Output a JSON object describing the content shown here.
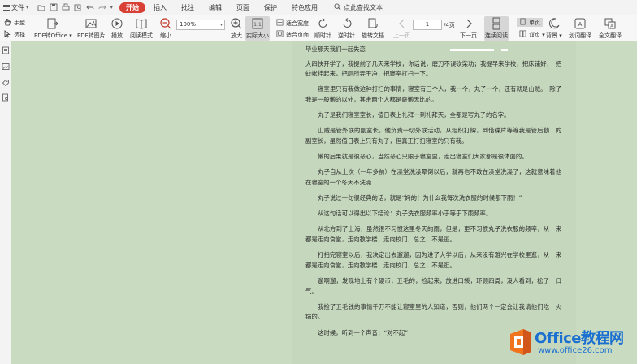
{
  "menubar": {
    "file_label": "文件",
    "tabs": [
      {
        "label": "开始",
        "active": true
      },
      {
        "label": "插入",
        "active": false
      },
      {
        "label": "批注",
        "active": false
      },
      {
        "label": "编辑",
        "active": false
      },
      {
        "label": "页面",
        "active": false
      },
      {
        "label": "保护",
        "active": false
      },
      {
        "label": "特色应用",
        "active": false
      }
    ],
    "search_label": "点此查找文本"
  },
  "ribbon": {
    "hand_tool": "手型",
    "select_tool": "选择",
    "pdf_to_office": "PDF转Office",
    "pdf_to_image": "PDF转图片",
    "play": "播放",
    "reading_mode": "阅读模式",
    "zoom_out": "缩小",
    "zoom_value": "100%",
    "zoom_in": "放大",
    "actual_size": "实际大小",
    "fit_width": "适合宽度",
    "fit_page": "适合页面",
    "rotate_cw": "顺时针",
    "rotate_ccw": "逆时针",
    "rotate_doc": "旋转文档",
    "prev_page": "上一页",
    "page_current": "1",
    "page_total": "/4页",
    "next_page": "下一页",
    "continuous_reading": "连续阅读",
    "single_page": "单页",
    "double_page": "双页",
    "background": "背景",
    "word_translate": "划词翻译",
    "full_translate": "全文翻译"
  },
  "document": {
    "title": "毕业那天我们一起失恋",
    "paragraphs": [
      "大四快开学了，我提前了几天来学校，你话说，磨刀不误砍柴功；我提早来学校，把床铺好，　把蚊帐挂起来，把厕所弄干净，把寝室打扫一下。",
      "寝室里只有我做这种打扫的事情，寝室有三个人，我一个，丸子一个，还有就是山贼。　除了我是一般懒的以外，其余两个人都是奇懒无比的。",
      "丸子是我们寝室室长，值日表上礼拜一到礼拜天，全都是写丸子的名字。",
      "山贼是管外联的副室长，他负责一切外联活动，从组织打牌，到借碟片等等我是管后勤　的副室长，虽然值日表上只有丸子，但真正打扫寝室的只有我。",
      "懒的后果就是很恶心，当然恶心只限于寝室里，走出寝室们大家都是很体面的。",
      "丸子自从上次（一年多前）在澡堂洗澡晕倒以后，就再也不敢在澡堂洗澡了，这就意味着他在寝室的一个冬天不洗澡……",
      "丸子说过一句很经典的话，就是“妈的！为什么我每次洗衣服的时候都下雨！”",
      "从这句话可以得出以下结论：丸子洗衣服频率小于等于下雨频率。",
      "从北方到了上海，虽然很不习惯这里冬天的雨，但是，更不习惯丸子洗衣服的频率，从　来都是走向食堂，走向教学楼，走向校门，总之，不是逃。",
      "打扫完寝室以后，我决定出去遛遛，因为进了大学以后，从来没有雅兴在学校里逛，从　来都是走向食堂，走向教学楼，走向校门，总之，不是逛。",
      "遛啊遛，发现地上有个硬币，五毛的，捡起来，放进口袋，环顾四周，没人看到，松了　口气。",
      "我捡了五毛钱的事情千万不能让寝室里的人知道，否则，他们两个一定会让我请他们吃　火锅的。",
      "这时候，听到一个声音：“对不起”"
    ]
  },
  "watermark": {
    "title": "Office教程网",
    "url": "www.office26.com"
  },
  "colors": {
    "accent_red": "#d84035",
    "page_bg": "#c5d8bd",
    "workspace_bg": "#c9dcc1",
    "logo_blue": "#1a6fd0",
    "logo_orange": "#f0731e"
  }
}
